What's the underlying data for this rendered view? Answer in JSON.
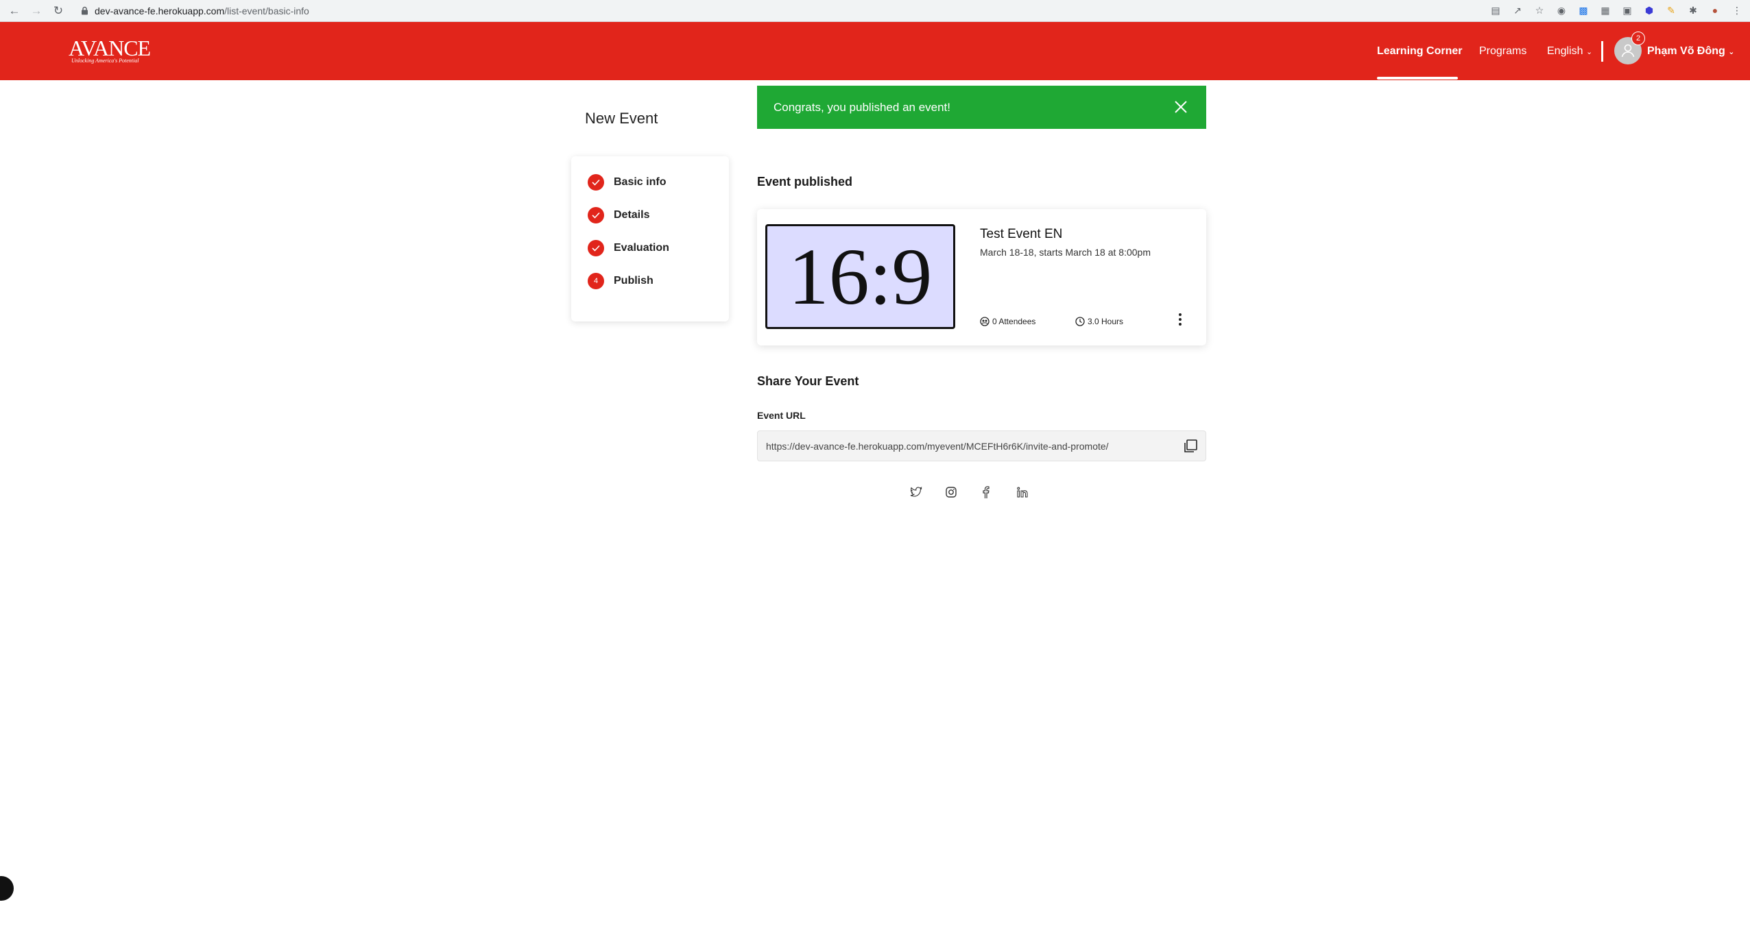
{
  "browser": {
    "url_host": "dev-avance-fe.herokuapp.com",
    "url_path": "/list-event/basic-info"
  },
  "header": {
    "logo_text": "AVANCE",
    "logo_tagline": "Unlocking America's Potential",
    "nav": {
      "learning_corner": "Learning Corner",
      "programs": "Programs",
      "language": "English",
      "user_name": "Phạm Võ Đông"
    },
    "notification_count": "2",
    "brand_color": "#e1251b"
  },
  "page": {
    "title": "New Event"
  },
  "steps": [
    {
      "label": "Basic info",
      "status": "done"
    },
    {
      "label": "Details",
      "status": "done"
    },
    {
      "label": "Evaluation",
      "status": "done"
    },
    {
      "label": "Publish",
      "status": "current",
      "number": "4"
    }
  ],
  "banner": {
    "message": "Congrats, you published an event!",
    "color": "#1fa834"
  },
  "published": {
    "heading": "Event published",
    "event": {
      "thumbnail_text": "16:9",
      "name": "Test Event EN",
      "date_text": "March 18-18, starts March 18 at 8:00pm",
      "attendees": "0 Attendees",
      "duration": "3.0 Hours"
    }
  },
  "share": {
    "heading": "Share Your Event",
    "url_label": "Event URL",
    "url_value": "https://dev-avance-fe.herokuapp.com/myevent/MCEFtH6r6K/invite-and-promote/",
    "social_icons": [
      "twitter-icon",
      "instagram-icon",
      "facebook-icon",
      "linkedin-icon"
    ]
  }
}
